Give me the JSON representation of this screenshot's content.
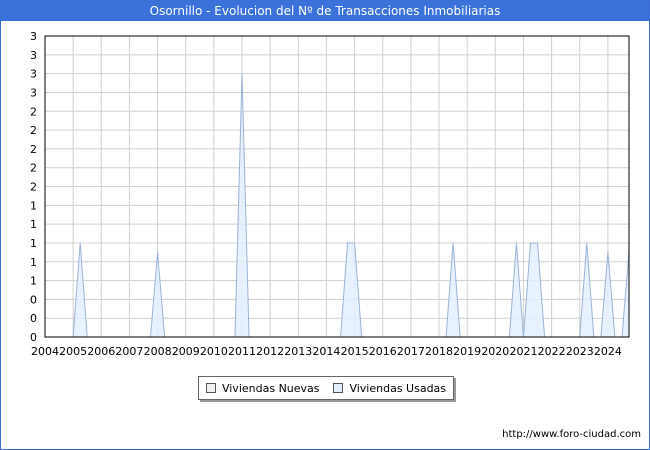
{
  "header": {
    "title": "Osornillo - Evolucion del Nº de Transacciones Inmobiliarias"
  },
  "footer": {
    "url": "http://www.foro-ciudad.com"
  },
  "colors": {
    "title_bar": "#3b72d9",
    "nuevas_fill": "#f2f2f2",
    "usadas_fill": "#e3efff",
    "usadas_stroke": "#9ab3d6",
    "grid": "#d0d0d0"
  },
  "chart_data": {
    "type": "area",
    "title": "Osornillo - Evolucion del Nº de Transacciones Inmobiliarias",
    "xlim": [
      2004,
      2024.75
    ],
    "ylim": [
      0,
      3.2
    ],
    "x_ticks": [
      2004,
      2005,
      2006,
      2007,
      2008,
      2009,
      2010,
      2011,
      2012,
      2013,
      2014,
      2015,
      2016,
      2017,
      2018,
      2019,
      2020,
      2021,
      2022,
      2023,
      2024
    ],
    "y_ticks": [
      0,
      0.2,
      0.4,
      0.6,
      0.8,
      1.0,
      1.2,
      1.4,
      1.6,
      1.8,
      2.0,
      2.2,
      2.4,
      2.6,
      2.8,
      3.0,
      3.2
    ],
    "y_tick_labels": [
      "0",
      "0",
      "0",
      "1",
      "1",
      "1",
      "1",
      "1",
      "2",
      "2",
      "2",
      "2",
      "2",
      "3",
      "3",
      "3",
      "3"
    ],
    "grid": true,
    "legend": {
      "position": "bottom-center",
      "entries": [
        "Viviendas Nuevas",
        "Viviendas Usadas"
      ]
    },
    "series": [
      {
        "name": "Viviendas Nuevas",
        "x": [
          2004,
          2024.75
        ],
        "y": [
          0,
          0
        ]
      },
      {
        "name": "Viviendas Usadas",
        "x": [
          2004,
          2005.0,
          2005.25,
          2005.5,
          2007.75,
          2008.0,
          2008.25,
          2010.75,
          2011.0,
          2011.25,
          2014.5,
          2014.75,
          2015.0,
          2015.25,
          2018.25,
          2018.5,
          2018.75,
          2020.5,
          2020.75,
          2021.0,
          2021.25,
          2021.5,
          2021.75,
          2022.0,
          2023.0,
          2023.25,
          2023.5,
          2023.75,
          2024.0,
          2024.25,
          2024.5,
          2024.75
        ],
        "y": [
          0,
          0,
          1,
          0,
          0,
          0.9,
          0,
          0,
          2.8,
          0,
          0,
          1,
          1,
          0,
          0,
          1,
          0,
          0,
          1,
          0,
          1,
          1,
          0,
          0,
          0,
          1,
          0,
          0,
          0.9,
          0,
          0,
          0.9
        ]
      }
    ]
  }
}
